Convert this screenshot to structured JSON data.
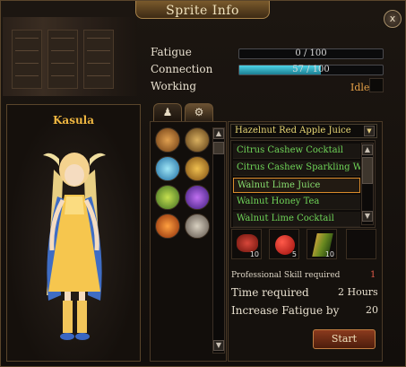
{
  "window": {
    "title": "Sprite Info",
    "close_icon": "x"
  },
  "stats": {
    "fatigue": {
      "label": "Fatigue",
      "value": "0 / 100",
      "fraction": 0.0
    },
    "connection": {
      "label": "Connection",
      "value": "57 / 100",
      "fraction": 0.57
    },
    "working": {
      "label": "Working",
      "status": "Idle"
    }
  },
  "sprite": {
    "name": "Kasula"
  },
  "tabs": [
    {
      "icon": "person-icon"
    },
    {
      "icon": "gear-clock-icon",
      "active": true
    }
  ],
  "skills": {
    "selected_recipe": "Hazelnut Red Apple Juice",
    "recipes": [
      "Citrus Cashew Cocktail",
      "Citrus Cashew Sparkling W",
      "Walnut Lime Juice",
      "Walnut Honey Tea",
      "Walnut Lime Cocktail"
    ],
    "selected_index": 2,
    "ingredients": [
      {
        "icon": "red-meat-icon",
        "count": "10"
      },
      {
        "icon": "red-apple-icon",
        "count": "5"
      },
      {
        "icon": "herb-bundle-icon",
        "count": "10"
      }
    ]
  },
  "details": {
    "skill_required_label": "Professional Skill required",
    "skill_required_value": "1",
    "time_label": "Time required",
    "time_value": "2 Hours",
    "fatigue_label": "Increase Fatigue by",
    "fatigue_value": "20"
  },
  "start_label": "Start",
  "colors": {
    "accent": "#efb640",
    "bar": "#2fb2c8",
    "recipe_text": "#6fd558",
    "selected_border": "#d98b2b"
  }
}
